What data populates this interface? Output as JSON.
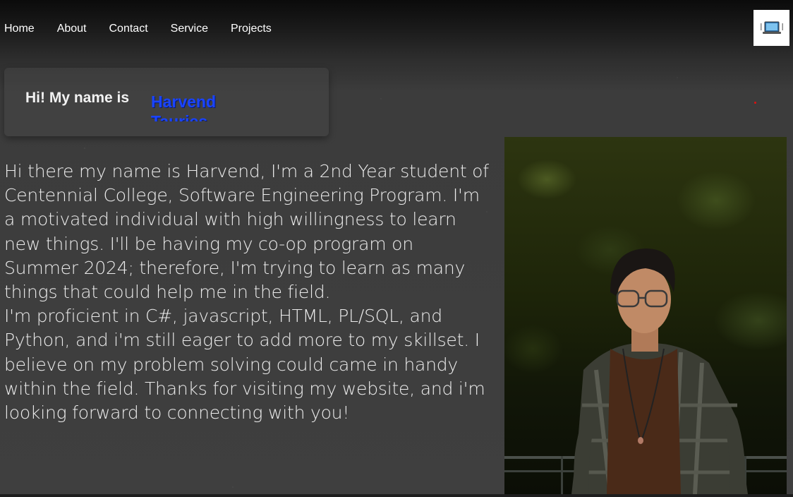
{
  "nav": {
    "links": [
      "Home",
      "About",
      "Contact",
      "Service",
      "Projects"
    ],
    "logo_icon": "laptop-icon"
  },
  "intro": {
    "greeting": "Hi! My name is",
    "names": [
      "Harvend",
      "Tauries"
    ],
    "name_color": "#1a44ff"
  },
  "bio": {
    "paragraph1": "Hi there my name is Harvend, I'm a 2nd Year student of Centennial College, Software Engineering Program. I'm a motivated individual with high willingness to learn new things. I'll be having my co-op program on Summer 2024; therefore, I'm trying to learn as many things that could help me in the field.",
    "paragraph2": "I'm proficient in C#, javascript, HTML, PL/SQL, and Python, and i'm still eager to add more to my skillset. I believe on my problem solving could came in handy within the field. Thanks for visiting my website, and i'm looking forward to connecting with you!"
  },
  "photo": {
    "icon": "profile-photo"
  }
}
